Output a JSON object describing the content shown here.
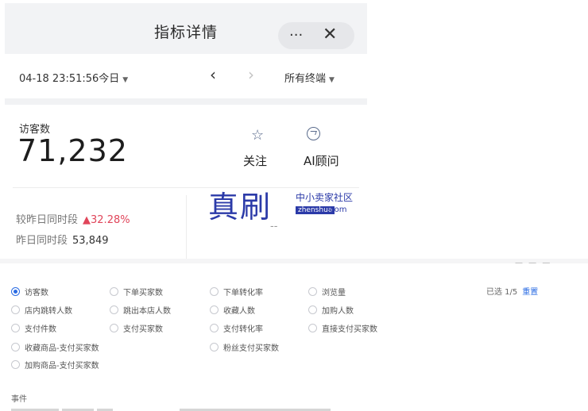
{
  "header": {
    "title": "指标详情",
    "more_glyph": "···",
    "close_glyph": "✕"
  },
  "toolbar": {
    "date": "04-18 23:51:56今日",
    "caret": "▼",
    "prev_glyph": "‹",
    "next_glyph": "›",
    "terminal": "所有终端"
  },
  "metric": {
    "label": "访客数",
    "value": "71,232",
    "follow_icon": "☆",
    "follow_label": "关注",
    "ai_label": "AI顾问"
  },
  "comparison": {
    "vs_label": "较昨日同时段",
    "change": "▲32.28%",
    "yesterday_label": "昨日同时段",
    "yesterday_value": "53,849",
    "right_placeholder": "--"
  },
  "watermark": {
    "big": "真刷",
    "small": "中小卖家社区",
    "box": "zhenshua",
    "domain": ".com"
  },
  "options": [
    {
      "label": "访客数",
      "selected": true
    },
    {
      "label": "下单买家数",
      "selected": false
    },
    {
      "label": "下单转化率",
      "selected": false
    },
    {
      "label": "浏览量",
      "selected": false
    },
    {
      "label": "店内跳转人数",
      "selected": false
    },
    {
      "label": "跳出本店人数",
      "selected": false
    },
    {
      "label": "收藏人数",
      "selected": false
    },
    {
      "label": "加购人数",
      "selected": false
    },
    {
      "label": "支付件数",
      "selected": false
    },
    {
      "label": "支付买家数",
      "selected": false
    },
    {
      "label": "支付转化率",
      "selected": false
    },
    {
      "label": "直接支付买家数",
      "selected": false
    },
    {
      "label": "收藏商品-支付买家数",
      "selected": false
    },
    {
      "label": "粉丝支付买家数",
      "selected": false
    },
    {
      "label": "加购商品-支付买家数",
      "selected": false
    }
  ],
  "selection": {
    "count": "已选 1/5",
    "reset": "重置"
  },
  "events": {
    "label": "事件"
  },
  "colors": {
    "accent": "#2b6ce3",
    "up": "#e0455a",
    "watermark": "#2b3aa8"
  }
}
